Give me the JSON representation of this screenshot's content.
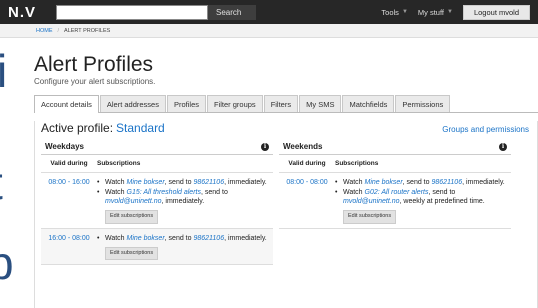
{
  "topbar": {
    "logo": "N.V",
    "search_button": "Search",
    "tools": "Tools",
    "my_stuff": "My stuff",
    "logout": "Logout mvold"
  },
  "breadcrumb": {
    "home": "HOME",
    "current": "ALERT PROFILES"
  },
  "page": {
    "title": "Alert Profiles",
    "subtitle": "Configure your alert subscriptions."
  },
  "tabs": [
    {
      "label": "Account details"
    },
    {
      "label": "Alert addresses"
    },
    {
      "label": "Profiles"
    },
    {
      "label": "Filter groups"
    },
    {
      "label": "Filters"
    },
    {
      "label": "My SMS"
    },
    {
      "label": "Matchfields"
    },
    {
      "label": "Permissions"
    }
  ],
  "active_profile": {
    "label": "Active profile:",
    "name": "Standard",
    "groups_link": "Groups and permissions"
  },
  "table_headers": {
    "valid": "Valid during",
    "subscriptions": "Subscriptions"
  },
  "weekdays": {
    "title": "Weekdays",
    "rows": [
      {
        "time": "08:00 - 16:00",
        "s1": {
          "pre": "Watch ",
          "link": "Mine bokser",
          "mid": ", send to ",
          "target": "98621106",
          "post": ", immediately."
        },
        "s2": {
          "pre": "Watch ",
          "link": "G15: All threshold alerts",
          "mid": ", send to ",
          "target": "mvold@uninett.no",
          "post": ", immediately."
        },
        "edit": "Edit subscriptions"
      },
      {
        "time": "16:00 - 08:00",
        "s1": {
          "pre": "Watch ",
          "link": "Mine bokser",
          "mid": ", send to ",
          "target": "98621106",
          "post": ", immediately."
        },
        "edit": "Edit subscriptions"
      }
    ]
  },
  "weekends": {
    "title": "Weekends",
    "rows": [
      {
        "time": "08:00 - 08:00",
        "s1": {
          "pre": "Watch ",
          "link": "Mine bokser",
          "mid": ", send to ",
          "target": "98621106",
          "post": ", immediately."
        },
        "s2": {
          "pre": "Watch ",
          "link": "G02: All router alerts",
          "mid": ", send to ",
          "target": "mvold@uninett.no",
          "post": ", weekly at predefined time."
        },
        "edit": "Edit subscriptions"
      }
    ]
  },
  "colors": {
    "link": "#1a73c7",
    "topbar": "#272727"
  }
}
